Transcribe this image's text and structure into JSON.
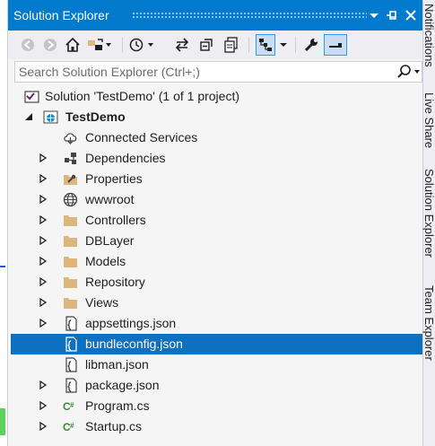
{
  "window": {
    "title": "Solution Explorer"
  },
  "search": {
    "placeholder": "Search Solution Explorer (Ctrl+;)"
  },
  "tree": {
    "solution_label": "Solution 'TestDemo' (1 of 1 project)",
    "project_label": "TestDemo",
    "items": [
      {
        "label": "Connected Services"
      },
      {
        "label": "Dependencies"
      },
      {
        "label": "Properties"
      },
      {
        "label": "wwwroot"
      },
      {
        "label": "Controllers"
      },
      {
        "label": "DBLayer"
      },
      {
        "label": "Models"
      },
      {
        "label": "Repository"
      },
      {
        "label": "Views"
      },
      {
        "label": "appsettings.json"
      },
      {
        "label": "bundleconfig.json"
      },
      {
        "label": "libman.json"
      },
      {
        "label": "package.json"
      },
      {
        "label": "Program.cs"
      },
      {
        "label": "Startup.cs"
      }
    ],
    "selected": "bundleconfig.json"
  },
  "side_tabs": [
    {
      "label": "Notifications"
    },
    {
      "label": "Live Share"
    },
    {
      "label": "Solution Explorer"
    },
    {
      "label": "Team Explorer"
    }
  ],
  "colors": {
    "titlebar": "#007acc",
    "selection": "#0e70c0",
    "folder": "#dcb67a",
    "csharp": "#388a34"
  }
}
